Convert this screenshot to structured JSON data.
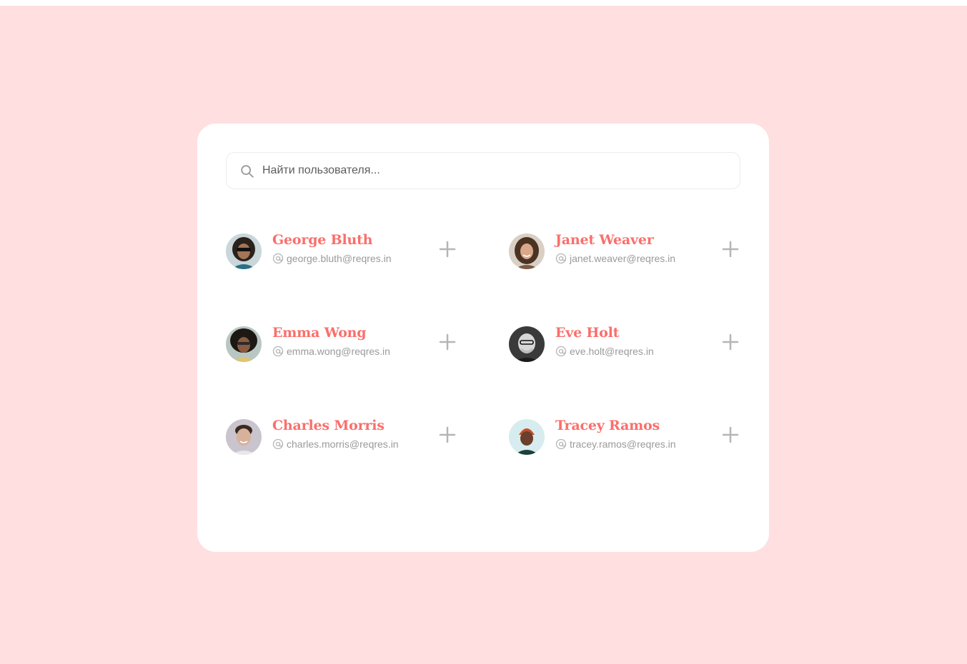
{
  "search": {
    "placeholder": "Найти пользователя..."
  },
  "colors": {
    "page_background": "#ffdfe0",
    "card_background": "#ffffff",
    "name_accent": "#fa6f6c",
    "email_text": "#9a9a9a",
    "plus_icon": "#b5b5b5"
  },
  "users": [
    {
      "name": "George Bluth",
      "email": "george.bluth@reqres.in"
    },
    {
      "name": "Janet Weaver",
      "email": "janet.weaver@reqres.in"
    },
    {
      "name": "Emma Wong",
      "email": "emma.wong@reqres.in"
    },
    {
      "name": "Eve Holt",
      "email": "eve.holt@reqres.in"
    },
    {
      "name": "Charles Morris",
      "email": "charles.morris@reqres.in"
    },
    {
      "name": "Tracey Ramos",
      "email": "tracey.ramos@reqres.in"
    }
  ],
  "icons": {
    "search": "search-icon",
    "email": "at-sign-icon",
    "add": "plus-icon"
  }
}
